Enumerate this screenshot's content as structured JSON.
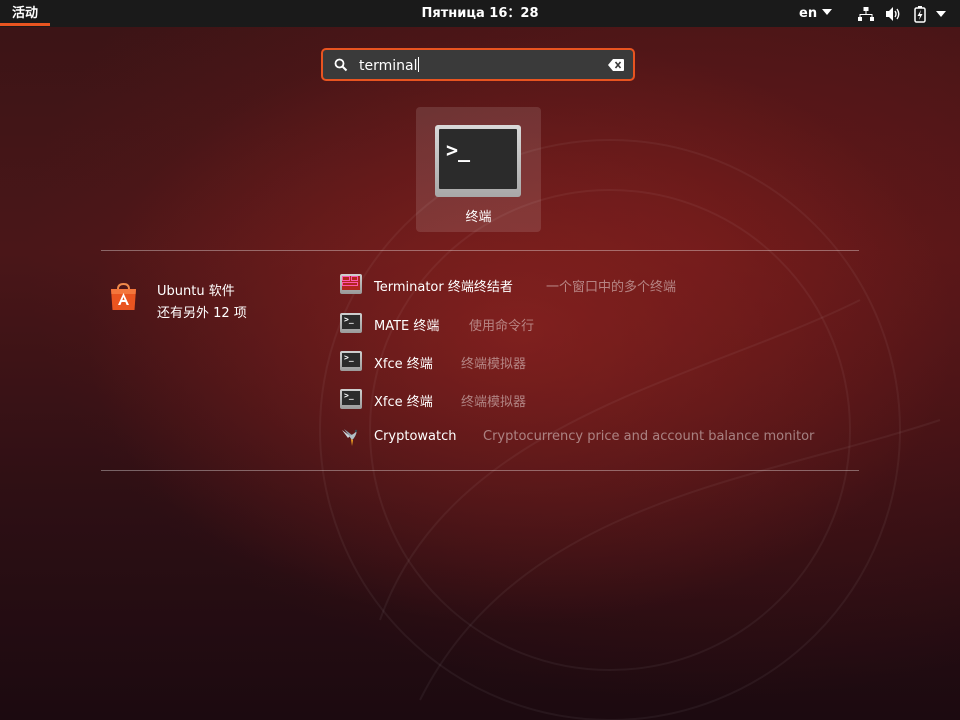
{
  "topbar": {
    "activities": "活动",
    "clock": "Пятница 16：28",
    "language": "en",
    "tray": [
      "network-icon",
      "volume-icon",
      "battery-icon",
      "system-menu-caret-icon"
    ]
  },
  "search": {
    "value": "terminal",
    "icons": {
      "search": "search-icon",
      "clear": "clear-text-icon"
    }
  },
  "top_result": {
    "label": "终端",
    "icon": "terminal-icon"
  },
  "provider": {
    "name": "Ubuntu 软件",
    "more": "还有另外 12 项",
    "icon": "ubuntu-software-icon"
  },
  "results": [
    {
      "name": "Terminator 终端终结者",
      "description": "一个窗口中的多个终端",
      "icon": "terminator-icon"
    },
    {
      "name": "MATE 终端",
      "description": "使用命令行",
      "icon": "terminal-icon"
    },
    {
      "name": "Xfce 终端",
      "description": "终端模拟器",
      "icon": "terminal-icon"
    },
    {
      "name": "Xfce 终端",
      "description": "终端模拟器",
      "icon": "terminal-icon"
    },
    {
      "name": "Cryptowatch",
      "description": "Cryptocurrency price and account balance monitor",
      "icon": "cryptowatch-bird-icon"
    }
  ],
  "colors": {
    "accent": "#e95420",
    "topbar": "#1a1a1a",
    "search_bg": "#3a3a3a"
  }
}
